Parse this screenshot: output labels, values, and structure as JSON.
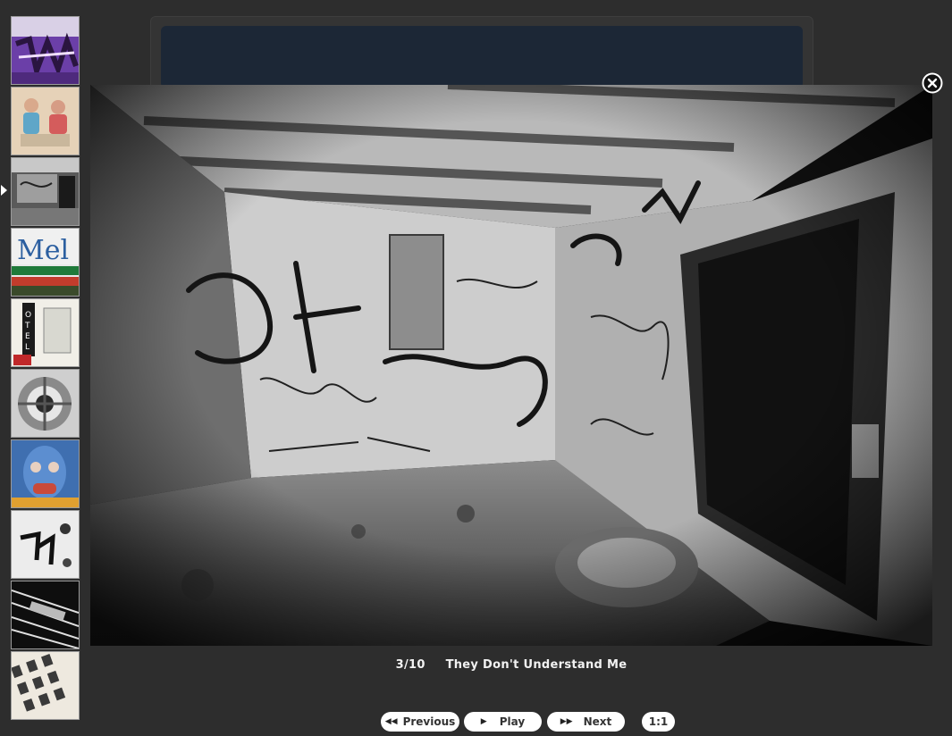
{
  "gallery": {
    "counter": "3/10",
    "title": "They Don't Understand Me",
    "thumbnails": [
      {
        "name": "thumbnail-1-purple-graffiti",
        "selected": false
      },
      {
        "name": "thumbnail-2-blurred-people",
        "selected": false
      },
      {
        "name": "thumbnail-3-graffiti-room",
        "selected": true
      },
      {
        "name": "thumbnail-4-mels-sign",
        "selected": false
      },
      {
        "name": "thumbnail-5-hotel-sign",
        "selected": false
      },
      {
        "name": "thumbnail-6-engine",
        "selected": false
      },
      {
        "name": "thumbnail-7-blue-mask",
        "selected": false
      },
      {
        "name": "thumbnail-8-bw-graffiti",
        "selected": false
      },
      {
        "name": "thumbnail-9-bw-lines",
        "selected": false
      },
      {
        "name": "thumbnail-10-building-windows",
        "selected": false
      }
    ]
  },
  "controls": {
    "previous_label": "Previous",
    "play_label": "Play",
    "next_label": "Next",
    "ratio_label": "1:1",
    "previous_icon": "rewind-icon",
    "play_icon": "play-icon",
    "next_icon": "fast-forward-icon"
  },
  "colors": {
    "page_background": "#2d2d2d",
    "header_background": "#1c2736",
    "button_background": "#ffffff",
    "caption_text": "#f2f2f2"
  }
}
